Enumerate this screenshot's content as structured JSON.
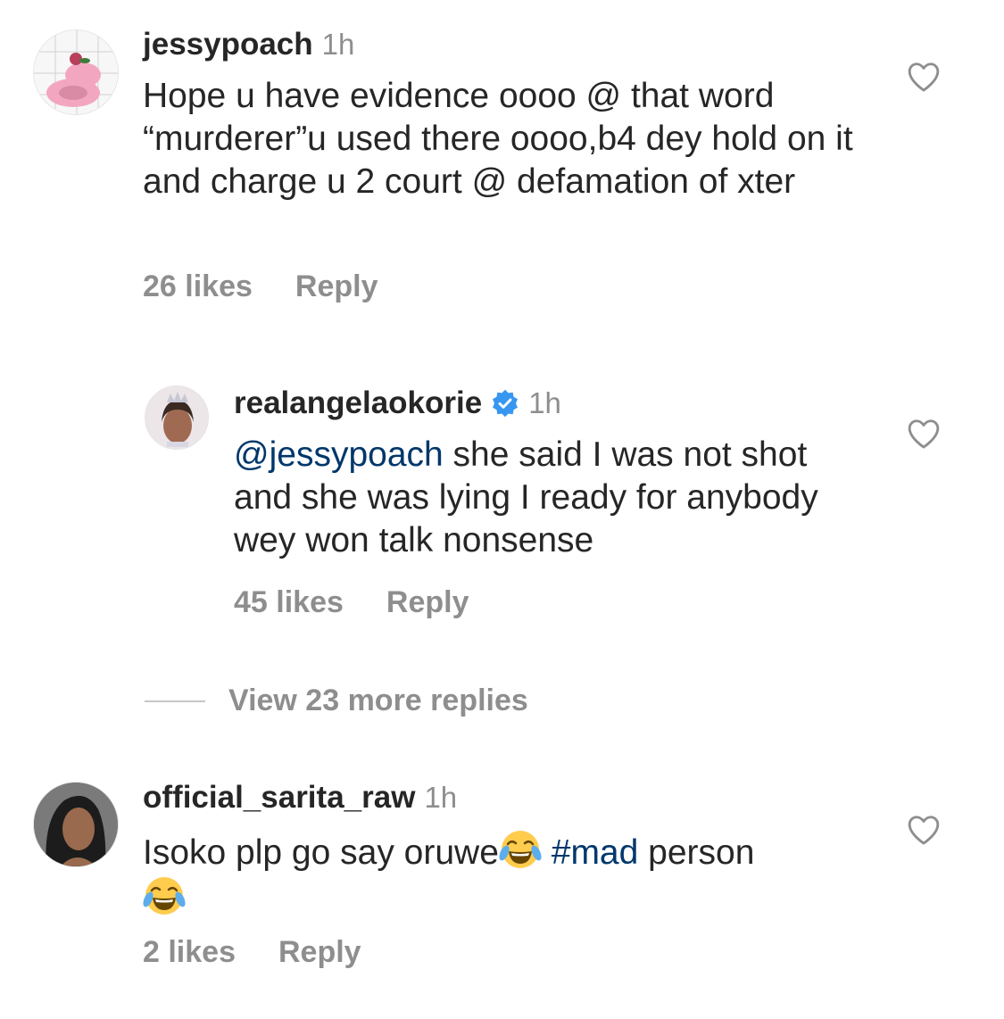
{
  "comments": [
    {
      "username": "jessypoach",
      "time": "1h",
      "text": "Hope u have evidence oooo @ that word “murderer”u used there oooo,b4 dey hold on it and charge u 2 court @ defamation of xter",
      "likes": "26 likes",
      "reply_label": "Reply"
    },
    {
      "username": "realangelaokorie",
      "time": "1h",
      "mention": "@jessypoach",
      "text": " she said I was not shot and she was lying I ready for anybody wey won talk nonsense",
      "likes": "45 likes",
      "reply_label": "Reply",
      "verified_icon": "verified-badge-icon"
    },
    {
      "username": "official_sarita_raw",
      "time": "1h",
      "text_before": "Isoko plp go say oruwe",
      "hashtag": "#mad",
      "text_after": " person",
      "likes": "2 likes",
      "reply_label": "Reply",
      "emoji_icon": "face-with-tears-of-joy-icon"
    }
  ],
  "view_more_replies": "View 23 more replies",
  "colors": {
    "text": "#262626",
    "secondary": "#8e8e8e",
    "link": "#00376b",
    "verified": "#3797f0"
  }
}
